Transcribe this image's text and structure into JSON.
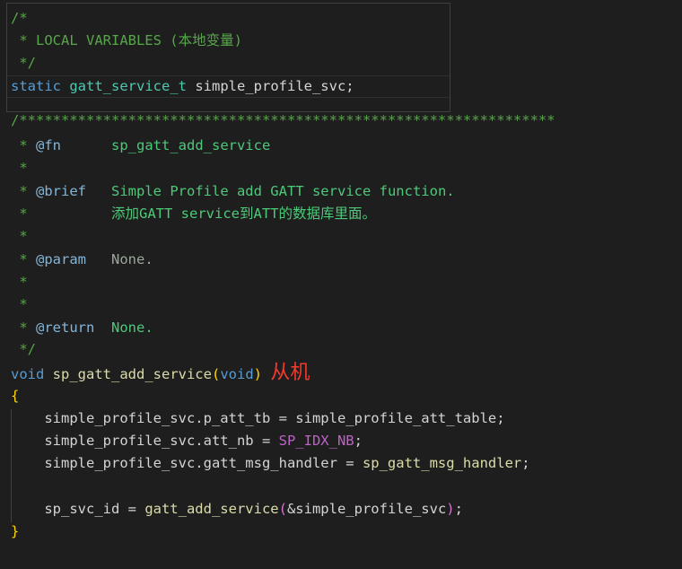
{
  "code": {
    "l1": "/*",
    "l2": " * LOCAL VARIABLES (本地变量)",
    "l3": " */",
    "l4_kw": "static",
    "l4_type": "gatt_service_t",
    "l4_rest": " simple_profile_svc;",
    "l5": "/****************************************************************",
    "l6_star": " * ",
    "l6_tag": "@fn",
    "l6_text": "sp_gatt_add_service",
    "l7": " *",
    "l8_star": " * ",
    "l8_tag": "@brief",
    "l8_text": "Simple Profile add GATT service function.",
    "l9_star": " *",
    "l9_text": "添加GATT service到ATT的数据库里面。",
    "l10": " *",
    "l11_star": " * ",
    "l11_tag": "@param",
    "l11_text": "None.",
    "l12": " *",
    "l13": " *",
    "l14_star": " * ",
    "l14_tag": "@return",
    "l14_text": "None.",
    "l15": " */",
    "l16_kw": "void",
    "l16_fn": "sp_gatt_add_service",
    "l16_open": "(",
    "l16_arg": "void",
    "l16_close": ")",
    "l16_note": "从机",
    "l17": "{",
    "l18_a": "simple_profile_svc.p_att_tb = simple_profile_att_table;",
    "l19_a": "simple_profile_svc.att_nb = ",
    "l19_macro": "SP_IDX_NB",
    "l19_end": ";",
    "l20_a": "simple_profile_svc.gatt_msg_handler = ",
    "l20_fn": "sp_gatt_msg_handler",
    "l20_end": ";",
    "l22_a": "sp_svc_id = ",
    "l22_fn": "gatt_add_service",
    "l22_open": "(",
    "l22_arg": "&simple_profile_svc",
    "l22_close": ")",
    "l22_end": ";",
    "l23": "}"
  }
}
